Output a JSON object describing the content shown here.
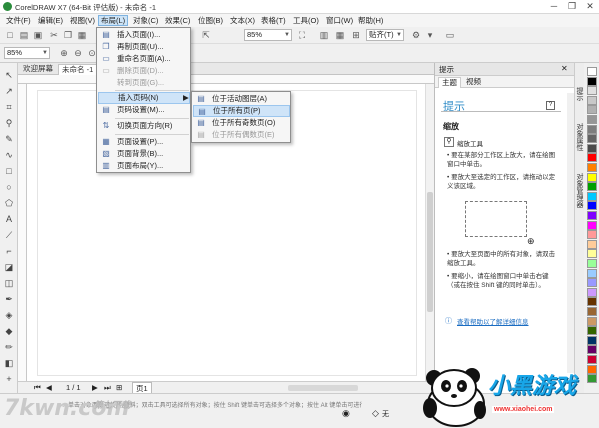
{
  "app": {
    "title": "CorelDRAW X7 (64-Bit 评估版) - 未命名 -1",
    "window_buttons": [
      "─",
      "❐",
      "✕"
    ]
  },
  "menubar": {
    "items": [
      "文件(F)",
      "编辑(E)",
      "视图(V)",
      "布局(L)",
      "对象(C)",
      "效果(C)",
      "位图(B)",
      "文本(X)",
      "表格(T)",
      "工具(O)",
      "窗口(W)",
      "帮助(H)"
    ],
    "active_index": 3
  },
  "toolbar": {
    "zoom_value": "85%",
    "snap_label": "贴齐(T)"
  },
  "propbar": {
    "zoom_value": "85%"
  },
  "doc_tabs": [
    "欢迎屏幕",
    "未命名 -1"
  ],
  "layout_menu": {
    "items": [
      {
        "label": "插入页面(I)...",
        "disabled": false
      },
      {
        "label": "再制页面(U)...",
        "disabled": false
      },
      {
        "label": "重命名页面(A)...",
        "disabled": false
      },
      {
        "label": "删除页面(D)...",
        "disabled": true
      },
      {
        "label": "转到页面(G)...",
        "disabled": true
      },
      {
        "label": "插入页码(N)",
        "disabled": false,
        "submenu": true
      },
      {
        "label": "页码设置(M)...",
        "disabled": false
      },
      {
        "label": "切换页面方向(R)",
        "disabled": false
      },
      {
        "label": "页面设置(P)...",
        "disabled": false
      },
      {
        "label": "页面背景(B)...",
        "disabled": false
      },
      {
        "label": "页面布局(Y)...",
        "disabled": false
      }
    ]
  },
  "insert_page_number_submenu": {
    "items": [
      {
        "label": "位于活动图层(A)",
        "disabled": false
      },
      {
        "label": "位于所有页(P)",
        "disabled": false
      },
      {
        "label": "位于所有奇数页(O)",
        "disabled": false
      },
      {
        "label": "位于所有偶数页(E)",
        "disabled": true
      }
    ]
  },
  "page_nav": {
    "counter": "1 / 1",
    "page_tab": "页1"
  },
  "docker": {
    "title": "提示",
    "tabs": [
      "主题",
      "视频"
    ],
    "heading": "提示",
    "section": "缩放",
    "tool_name": "缩放工具",
    "bullets": [
      "要在某部分工作区上放大，请在绘图窗口中单击。",
      "要放大至选定的工作区，请拖动以定义该区域。",
      "要放大至页面中的所有对象，请双击缩放工具。",
      "要缩小，请在绘图窗口中单击右键（或在按住 Shift 键的同时单击）。"
    ],
    "link": "查看帮助以了解详细信息"
  },
  "side_tabs": [
    "提示",
    "对象属性",
    "对象管理器"
  ],
  "status": {
    "hint": "…单击对象两次可旋转/倾斜；双击工具可选择所有对象；按住 Shift 键单击可选择多个对象；按住 Alt 键单击可进行挖掘；按住 Ctrl 并单击可在组中选择…",
    "fill": "无"
  },
  "palette_colors": [
    "#ffffff",
    "#000000",
    "#e0e0e0",
    "#c8c8c8",
    "#b0b0b0",
    "#969696",
    "#7d7d7d",
    "#646464",
    "#4b4b4b",
    "#ff0000",
    "#ff8000",
    "#ffff00",
    "#00a000",
    "#00c8ff",
    "#0000ff",
    "#8000ff",
    "#ff00ff",
    "#ff9999",
    "#ffcc99",
    "#ffff99",
    "#99ff99",
    "#99ccff",
    "#9999ff",
    "#cc99ff",
    "#663300",
    "#996633",
    "#cc9966",
    "#336600",
    "#003366",
    "#660066",
    "#cc0033",
    "#ff6600",
    "#339933"
  ],
  "watermarks": {
    "left": "7kwn.com",
    "left_sub": "第七下载",
    "right": "小黑游戏",
    "right_url": "www.xiaohei.com"
  },
  "colors": {
    "accent": "#2e8bc7",
    "menu_highlight": "#cde4f7"
  }
}
